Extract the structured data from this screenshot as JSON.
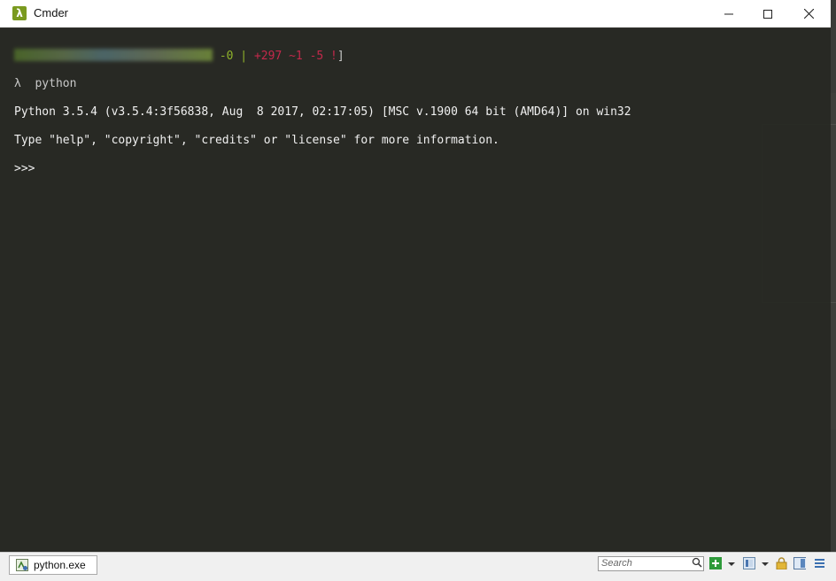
{
  "window": {
    "title": "Cmder",
    "app_icon_glyph": "λ",
    "accent": "#7a9a1f"
  },
  "terminal": {
    "prompt_status": {
      "part1": "-0 | ",
      "part2": "+297 ~1 -5 !",
      "part3": "]",
      "part1_color": "#8fb32b",
      "part2_color": "#c4294b"
    },
    "command_line": "λ  python",
    "output_line1": "Python 3.5.4 (v3.5.4:3f56838, Aug  8 2017, 02:17:05) [MSC v.1900 64 bit (AMD64)] on win32",
    "output_line2": "Type \"help\", \"copyright\", \"credits\" or \"license\" for more information.",
    "repl_prompt": ">>>",
    "background": "#272822"
  },
  "statusbar": {
    "tab_label": "python.exe",
    "search_placeholder": "Search"
  }
}
